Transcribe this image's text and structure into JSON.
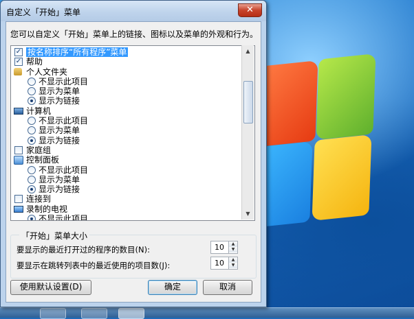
{
  "window": {
    "title": "自定义「开始」菜单",
    "close_label": "✕",
    "description": "您可以自定义「开始」菜单上的链接、图标以及菜单的外观和行为。"
  },
  "list": {
    "items": [
      {
        "type": "checkbox",
        "checked": true,
        "selected": true,
        "label": "按名称排序“所有程序”菜单"
      },
      {
        "type": "checkbox",
        "checked": true,
        "label": "帮助"
      },
      {
        "type": "header",
        "icon": "user-folder-icon",
        "label": "个人文件夹"
      },
      {
        "type": "radio",
        "checked": false,
        "label": "不显示此项目"
      },
      {
        "type": "radio",
        "checked": false,
        "label": "显示为菜单"
      },
      {
        "type": "radio",
        "checked": true,
        "label": "显示为链接"
      },
      {
        "type": "header",
        "icon": "computer-icon",
        "label": "计算机"
      },
      {
        "type": "radio",
        "checked": false,
        "label": "不显示此项目"
      },
      {
        "type": "radio",
        "checked": false,
        "label": "显示为菜单"
      },
      {
        "type": "radio",
        "checked": true,
        "label": "显示为链接"
      },
      {
        "type": "checkbox",
        "checked": false,
        "label": "家庭组"
      },
      {
        "type": "header",
        "icon": "control-panel-icon",
        "label": "控制面板"
      },
      {
        "type": "radio",
        "checked": false,
        "label": "不显示此项目"
      },
      {
        "type": "radio",
        "checked": false,
        "label": "显示为菜单"
      },
      {
        "type": "radio",
        "checked": true,
        "label": "显示为链接"
      },
      {
        "type": "checkbox",
        "checked": false,
        "label": "连接到"
      },
      {
        "type": "header",
        "icon": "recorded-tv-icon",
        "label": "录制的电视"
      },
      {
        "type": "radio",
        "checked": true,
        "label": "不显示此项目"
      }
    ]
  },
  "menu_size": {
    "title": "「开始」菜单大小",
    "recent_programs_label": "要显示的最近打开过的程序的数目(N):",
    "recent_programs_value": "10",
    "jumplist_label": "要显示在跳转列表中的最近使用的项目数(J):",
    "jumplist_value": "10"
  },
  "buttons": {
    "defaults": "使用默认设置(D)",
    "ok": "确定",
    "cancel": "取消"
  }
}
